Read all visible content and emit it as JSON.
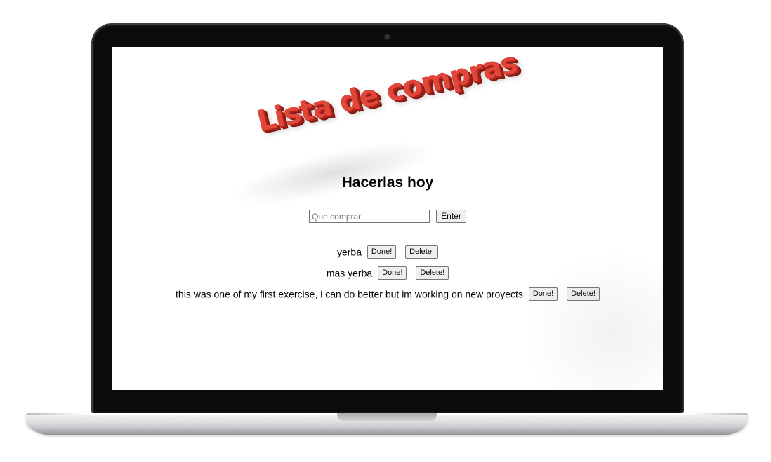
{
  "app": {
    "wordart_title": "Lista de compras",
    "subtitle": "Hacerlas hoy"
  },
  "form": {
    "input_placeholder": "Que comprar",
    "input_value": "",
    "enter_label": "Enter"
  },
  "items": [
    {
      "text": "yerba",
      "done_label": "Done!",
      "delete_label": "Delete!"
    },
    {
      "text": "mas yerba",
      "done_label": "Done!",
      "delete_label": "Delete!"
    },
    {
      "text": "this was one of my first exercise, i can do better but im working on new proyects",
      "done_label": "Done!",
      "delete_label": "Delete!"
    }
  ],
  "colors": {
    "wordart_face": "#e2463a",
    "wordart_extrude": "#9b1f15",
    "bezel": "#0b0b0c",
    "button_bg": "#efefef"
  },
  "icons": {
    "camera": "camera-dot-icon"
  }
}
